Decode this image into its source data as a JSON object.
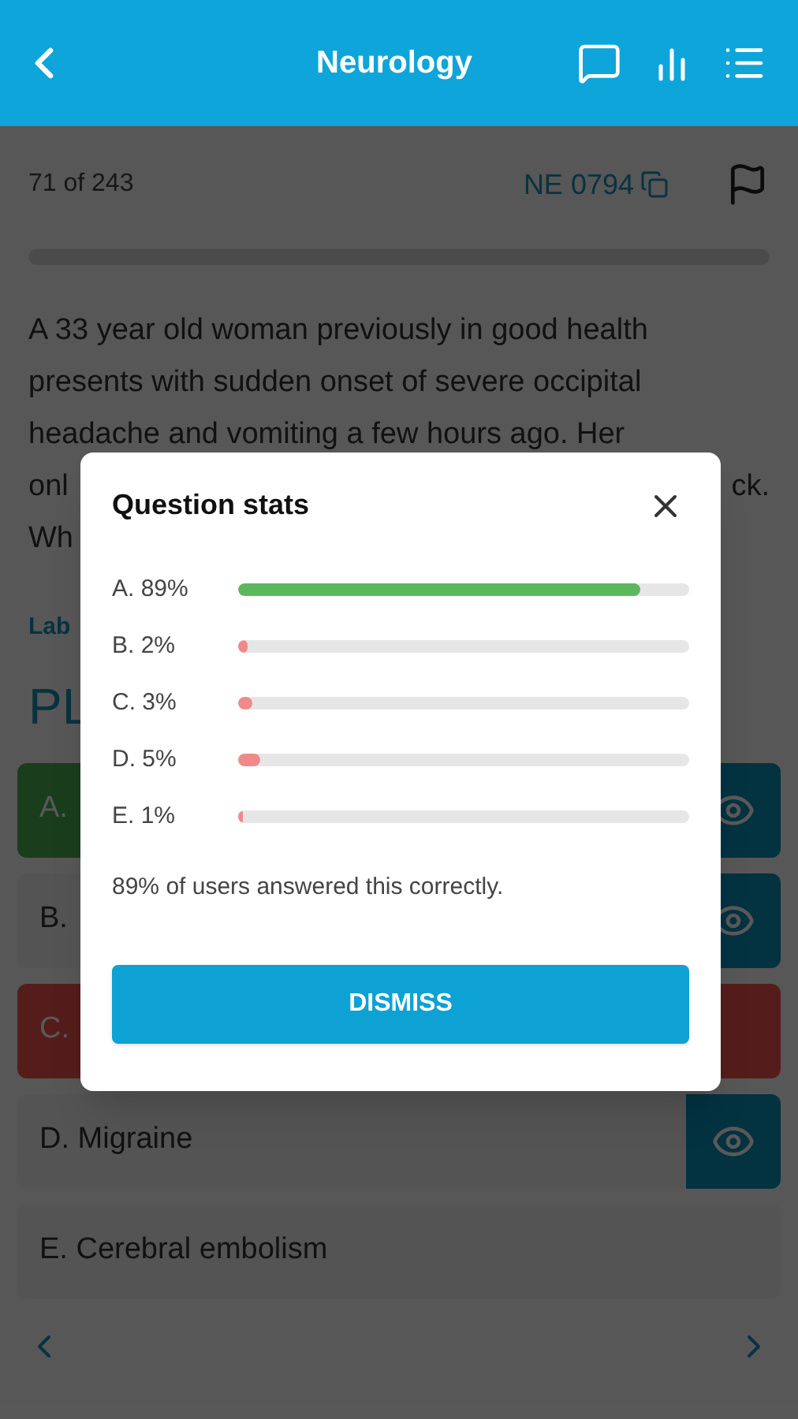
{
  "header": {
    "title": "Neurology"
  },
  "meta": {
    "position": "71 of 243",
    "code": "NE 0794"
  },
  "question": {
    "lines": [
      {
        "left": "A 33 year old woman previously in good health"
      },
      {
        "left": "presents with sudden onset of severe occipital"
      },
      {
        "left": "headache and vomiting a few hours ago. Her"
      },
      {
        "left": "onl",
        "right": "ck."
      },
      {
        "left": "Wh"
      }
    ]
  },
  "lab_link": "Lab",
  "heading": "PL",
  "options": [
    {
      "label": "A.",
      "correct": true,
      "wrong": false,
      "eye": true
    },
    {
      "label": "B.",
      "correct": false,
      "wrong": false,
      "eye": true
    },
    {
      "label": "C.",
      "correct": false,
      "wrong": true,
      "eye": false
    },
    {
      "label": "D. Migraine",
      "correct": false,
      "wrong": false,
      "eye": true
    },
    {
      "label": "E. Cerebral embolism",
      "correct": false,
      "wrong": false,
      "eye": false
    }
  ],
  "dialog": {
    "title": "Question stats",
    "stats": [
      {
        "label": "A. 89%",
        "level": 0.89,
        "correct": true
      },
      {
        "label": "B. 2%",
        "level": 0.02,
        "correct": false
      },
      {
        "label": "C. 3%",
        "level": 0.03,
        "correct": false
      },
      {
        "label": "D. 5%",
        "level": 0.05,
        "correct": false
      },
      {
        "label": "E. 1%",
        "level": 0.01,
        "correct": false
      }
    ],
    "summary": "89% of users answered this correctly.",
    "button": "DISMISS"
  }
}
